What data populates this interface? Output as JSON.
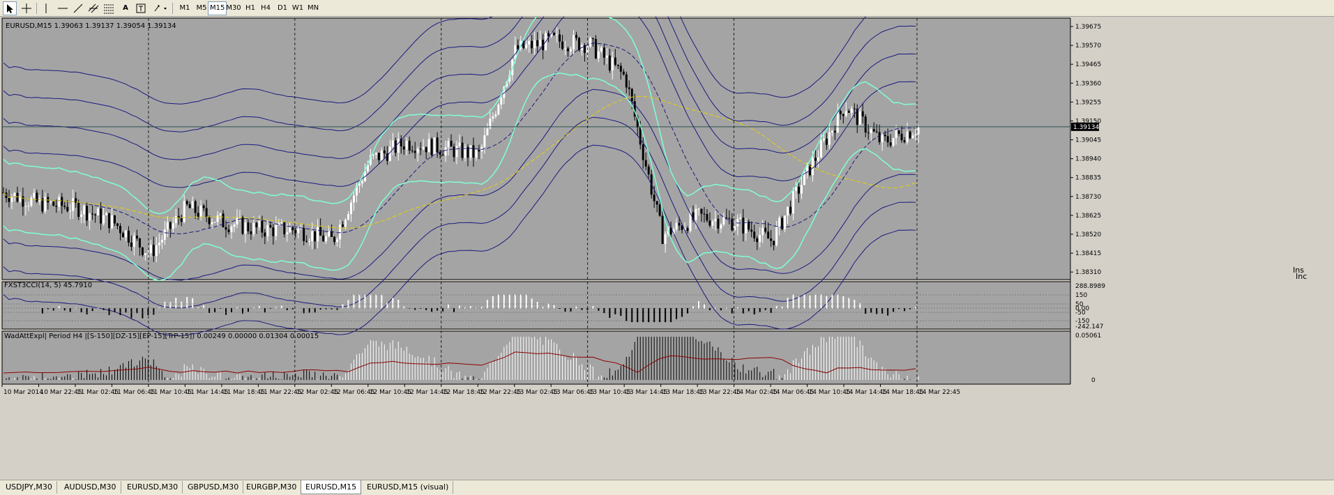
{
  "toolbar": {
    "tools": [
      "cursor",
      "crosshair",
      "vertical-line",
      "horizontal-line",
      "trend-line",
      "equidistant-channel",
      "fibonacci",
      "text",
      "text-label",
      "arrows"
    ],
    "text_tool": "A",
    "label_tool": "T",
    "timeframes": [
      "M1",
      "M5",
      "M15",
      "M30",
      "H1",
      "H4",
      "D1",
      "W1",
      "MN"
    ],
    "active_timeframe": "M15"
  },
  "main_chart": {
    "header": "EURUSD,M15  1.39063 1.39137 1.39054 1.39134",
    "price_labels": [
      "1.39675",
      "1.39570",
      "1.39465",
      "1.39360",
      "1.39255",
      "1.39150",
      "1.39045",
      "1.38940",
      "1.38835",
      "1.38730",
      "1.38625",
      "1.38520",
      "1.38415",
      "1.38310"
    ],
    "current_price": "1.39134",
    "corner_text_1": "Ins",
    "corner_text_2": "Inc"
  },
  "cci_panel": {
    "header": "FXST3CCI(14, 5) 45.7910",
    "labels": [
      "288.8989",
      "150",
      "50",
      "0.00",
      "-50",
      "-150",
      "-242.147"
    ]
  },
  "wad_panel": {
    "header": "WadAttExpl| Period H4 |[S-150][DZ-15][EP-15][TrP-15]) 0.00249 0.00000 0.01304 0.00015",
    "labels": [
      "0.05061",
      "0"
    ]
  },
  "time_axis": [
    "10 Mar 2014",
    "10 Mar 22:45",
    "11 Mar 02:45",
    "11 Mar 06:45",
    "11 Mar 10:45",
    "11 Mar 14:45",
    "11 Mar 18:45",
    "11 Mar 22:45",
    "12 Mar 02:45",
    "12 Mar 06:45",
    "12 Mar 10:45",
    "12 Mar 14:45",
    "12 Mar 18:45",
    "12 Mar 22:45",
    "13 Mar 02:45",
    "13 Mar 06:45",
    "13 Mar 10:45",
    "13 Mar 14:45",
    "13 Mar 18:45",
    "13 Mar 22:45",
    "14 Mar 02:45",
    "14 Mar 06:45",
    "14 Mar 10:45",
    "14 Mar 14:45",
    "14 Mar 18:45",
    "14 Mar 22:45"
  ],
  "tabs": [
    "USDJPY,M30",
    "AUDUSD,M30",
    "EURUSD,M30",
    "GBPUSD,M30",
    "EURGBP,M30",
    "EURUSD,M15",
    "EURUSD,M15 (visual)"
  ],
  "active_tab": "EURUSD,M15",
  "chart_data": {
    "type": "line",
    "title": "EURUSD,M15",
    "symbol": "EURUSD",
    "timeframe": "M15",
    "last_bar": {
      "open": 1.39063,
      "high": 1.39137,
      "low": 1.39054,
      "close": 1.39134
    },
    "ylim": [
      1.3831,
      1.3972
    ],
    "x": [
      "10 Mar 2014",
      "10 Mar 22:45",
      "11 Mar 02:45",
      "11 Mar 06:45",
      "11 Mar 10:45",
      "11 Mar 14:45",
      "11 Mar 18:45",
      "11 Mar 22:45",
      "12 Mar 02:45",
      "12 Mar 06:45",
      "12 Mar 10:45",
      "12 Mar 14:45",
      "12 Mar 18:45",
      "12 Mar 22:45",
      "13 Mar 02:45",
      "13 Mar 06:45",
      "13 Mar 10:45",
      "13 Mar 14:45",
      "13 Mar 18:45",
      "13 Mar 22:45",
      "14 Mar 02:45",
      "14 Mar 06:45",
      "14 Mar 10:45",
      "14 Mar 14:45",
      "14 Mar 18:45",
      "14 Mar 22:45"
    ],
    "series": [
      {
        "name": "EURUSD",
        "values": [
          1.3878,
          1.3872,
          1.387,
          1.3862,
          1.3845,
          1.387,
          1.3862,
          1.3858,
          1.3858,
          1.3852,
          1.3895,
          1.3905,
          1.3902,
          1.3898,
          1.3955,
          1.396,
          1.3958,
          1.394,
          1.3855,
          1.3865,
          1.3862,
          1.3852,
          1.389,
          1.3925,
          1.3905,
          1.3913
        ]
      }
    ],
    "colors": {
      "background": "#a4a4a4",
      "bull": "#ffffff",
      "bear": "#000000",
      "bands": "#7fffd4",
      "envelope": "#1a1a80",
      "ma": "#e6d200"
    }
  }
}
